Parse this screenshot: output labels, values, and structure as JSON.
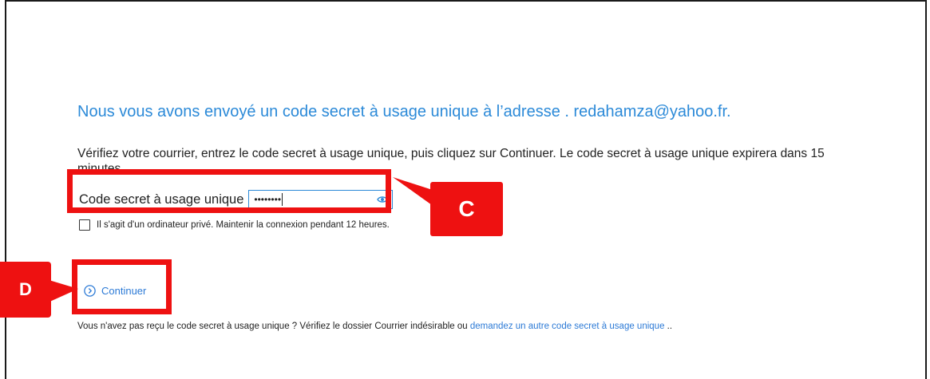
{
  "title": "Nous vous avons envoyé un code secret à usage unique à l’adresse . redahamza@yahoo.fr.",
  "instructions": "Vérifiez votre courrier, entrez le code secret à usage unique, puis cliquez sur Continuer. Le code secret à usage unique expirera dans 15 minutes.",
  "code_field": {
    "label": "Code secret à usage unique",
    "masked_value": "••••••••",
    "reveal_icon": "eye-icon"
  },
  "remember": {
    "label": "Il s'agit d'un ordinateur privé. Maintenir la connexion pendant 12 heures.",
    "checked": false
  },
  "continue_button": {
    "label": "Continuer",
    "icon": "chevron-right-circle-icon"
  },
  "footer": {
    "text": "Vous n'avez pas reçu le code secret à usage unique ? Vérifiez le dossier Courrier indésirable ou ",
    "link": "demandez un autre code secret à usage unique",
    "suffix": " .."
  },
  "annotations": {
    "c_label": "C",
    "d_label": "D",
    "color": "#ee1111"
  },
  "colors": {
    "accent": "#2c8ad8",
    "link": "#2c7ad6"
  }
}
